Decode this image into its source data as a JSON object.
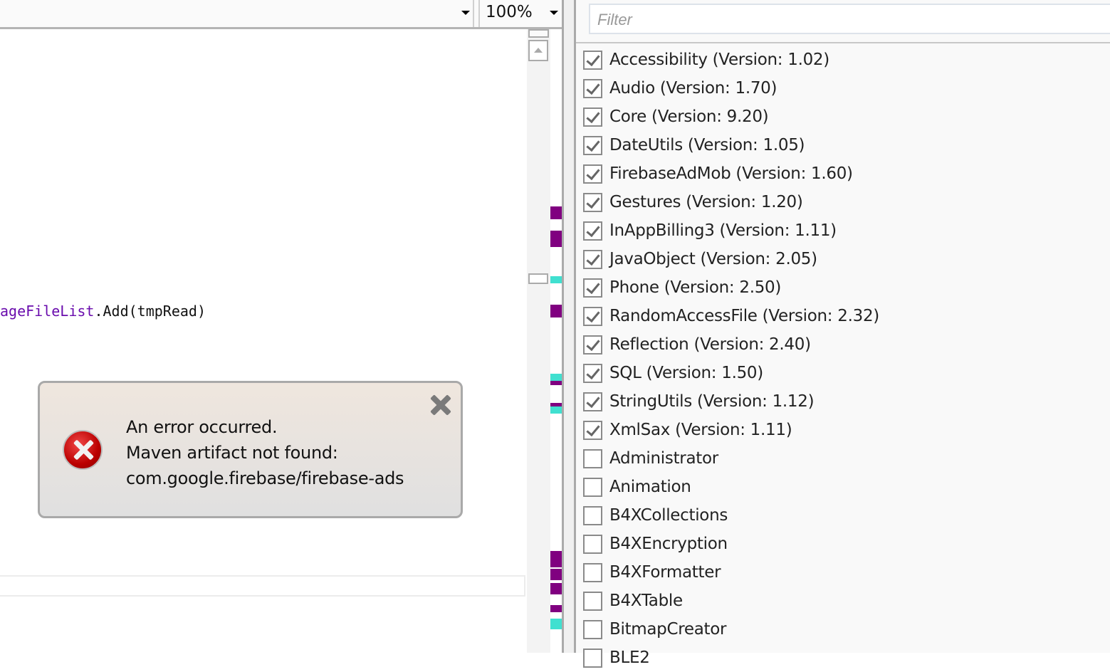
{
  "toolbar": {
    "zoom_value": "100%"
  },
  "editor": {
    "code_identifier": "ageFileList",
    "code_rest": ".Add(tmpRead)"
  },
  "marker_colors": {
    "purple": "#800080",
    "cyan": "#40e0d0"
  },
  "libraries": {
    "filter_placeholder": "Filter",
    "items": [
      {
        "label": "Accessibility (Version: 1.02)",
        "checked": true
      },
      {
        "label": "Audio (Version: 1.70)",
        "checked": true
      },
      {
        "label": "Core (Version: 9.20)",
        "checked": true
      },
      {
        "label": "DateUtils (Version: 1.05)",
        "checked": true
      },
      {
        "label": "FirebaseAdMob (Version: 1.60)",
        "checked": true
      },
      {
        "label": "Gestures (Version: 1.20)",
        "checked": true
      },
      {
        "label": "InAppBilling3 (Version: 1.11)",
        "checked": true
      },
      {
        "label": "JavaObject (Version: 2.05)",
        "checked": true
      },
      {
        "label": "Phone (Version: 2.50)",
        "checked": true
      },
      {
        "label": "RandomAccessFile (Version: 2.32)",
        "checked": true
      },
      {
        "label": "Reflection (Version: 2.40)",
        "checked": true
      },
      {
        "label": "SQL (Version: 1.50)",
        "checked": true
      },
      {
        "label": "StringUtils (Version: 1.12)",
        "checked": true
      },
      {
        "label": "XmlSax (Version: 1.11)",
        "checked": true
      },
      {
        "label": "Administrator",
        "checked": false
      },
      {
        "label": "Animation",
        "checked": false
      },
      {
        "label": "B4XCollections",
        "checked": false
      },
      {
        "label": "B4XEncryption",
        "checked": false
      },
      {
        "label": "B4XFormatter",
        "checked": false
      },
      {
        "label": "B4XTable",
        "checked": false
      },
      {
        "label": "BitmapCreator",
        "checked": false
      },
      {
        "label": "BLE2",
        "checked": false
      }
    ]
  },
  "error_dialog": {
    "line1": "An error occurred.",
    "line2": "Maven artifact not found:",
    "line3": "com.google.firebase/firebase-ads"
  }
}
